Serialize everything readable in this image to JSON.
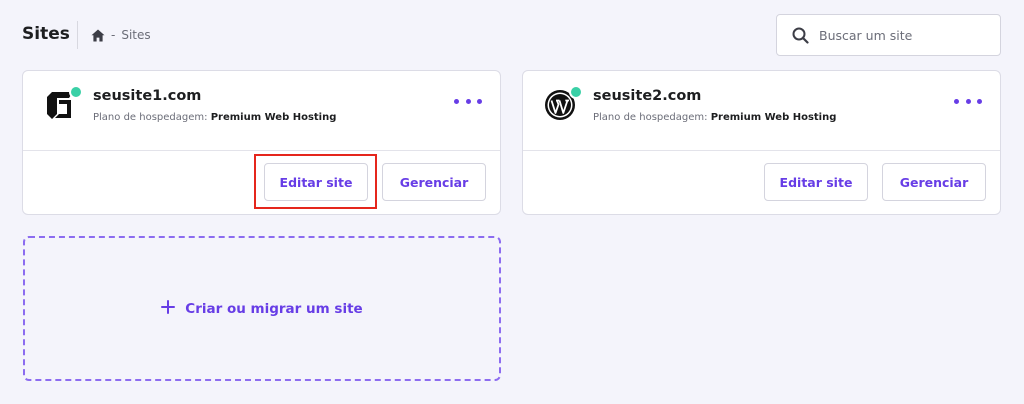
{
  "header": {
    "title": "Sites",
    "breadcrumb_separator": "-",
    "breadcrumb_current": "Sites"
  },
  "search": {
    "placeholder": "Buscar um site",
    "value": ""
  },
  "sites": [
    {
      "name": "seusite1.com",
      "plan_label": "Plano de hospedagem:",
      "plan_value": "Premium Web Hosting",
      "edit_label": "Editar site",
      "manage_label": "Gerenciar",
      "logo_icon": "custom-cube-logo-icon",
      "status": "active"
    },
    {
      "name": "seusite2.com",
      "plan_label": "Plano de hospedagem:",
      "plan_value": "Premium Web Hosting",
      "edit_label": "Editar site",
      "manage_label": "Gerenciar",
      "logo_icon": "wordpress-logo-icon",
      "status": "active"
    }
  ],
  "create_site": {
    "label": "Criar ou migrar um site"
  },
  "colors": {
    "accent": "#673de6",
    "status_active": "#3ad0a6",
    "highlight": "#e5261c",
    "background": "#f4f4fb"
  }
}
